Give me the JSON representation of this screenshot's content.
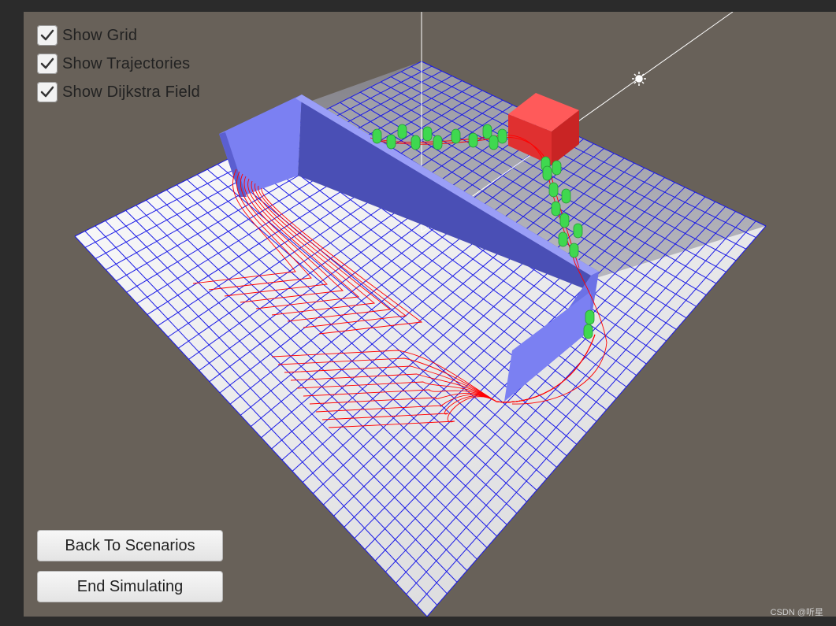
{
  "toggles": [
    {
      "label": "Show Grid",
      "checked": true
    },
    {
      "label": "Show Trajectories",
      "checked": true
    },
    {
      "label": "Show Dijkstra Field",
      "checked": true
    }
  ],
  "buttons": {
    "back": "Back To Scenarios",
    "end": "End Simulating"
  },
  "watermark": "CSDN @听星",
  "colors": {
    "viewport_bg": "#686159",
    "grid_line": "#1a1ae6",
    "wall": "#7b7ff0",
    "agent": "#44dd55",
    "trajectory": "#ff0000",
    "goal_cube": "#e83a3a"
  }
}
